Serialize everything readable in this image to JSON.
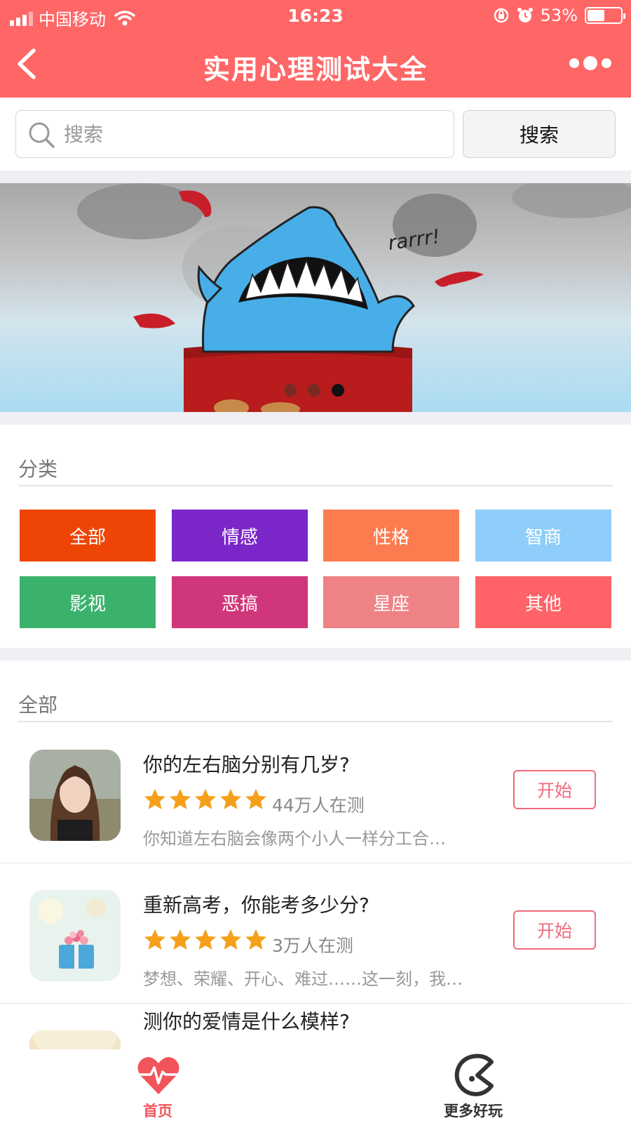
{
  "status_bar": {
    "carrier": "中国移动",
    "time": "16:23",
    "battery": "53%",
    "battery_level": 0.53
  },
  "nav": {
    "title": "实用心理测试大全"
  },
  "search": {
    "placeholder": "搜索",
    "button_label": "搜索"
  },
  "banner": {
    "caption": "rarrr!",
    "slide_count": 3,
    "active_slide": 3
  },
  "categories": {
    "title": "分类",
    "items": [
      {
        "label": "全部",
        "color": "#ee4405"
      },
      {
        "label": "情感",
        "color": "#7b26c9"
      },
      {
        "label": "性格",
        "color": "#fd7c4f"
      },
      {
        "label": "智商",
        "color": "#8fcefa"
      },
      {
        "label": "影视",
        "color": "#3bb26b"
      },
      {
        "label": "恶搞",
        "color": "#d0367a"
      },
      {
        "label": "星座",
        "color": "#ee8284"
      },
      {
        "label": "其他",
        "color": "#ff6367"
      }
    ]
  },
  "list": {
    "title": "全部",
    "items": [
      {
        "title": "你的左右脑分别有几岁?",
        "rating": 5,
        "count": "44万人在测",
        "desc": "你知道左右脑会像两个小人一样分工合…",
        "button": "开始"
      },
      {
        "title": "重新高考，你能考多少分?",
        "rating": 5,
        "count": "3万人在测",
        "desc": "梦想、荣耀、开心、难过……这一刻，我…",
        "button": "开始"
      },
      {
        "title": "测你的爱情是什么模样?"
      }
    ]
  },
  "tabbar": {
    "items": [
      {
        "label": "首页",
        "icon": "heartbeat-icon",
        "active": true,
        "color": "#f2545b"
      },
      {
        "label": "更多好玩",
        "icon": "pacman-icon",
        "active": false,
        "color": "#333333"
      }
    ]
  },
  "colors": {
    "header": "#ff6666",
    "star": "#f5a01a",
    "start_button": "#f06a7c"
  }
}
